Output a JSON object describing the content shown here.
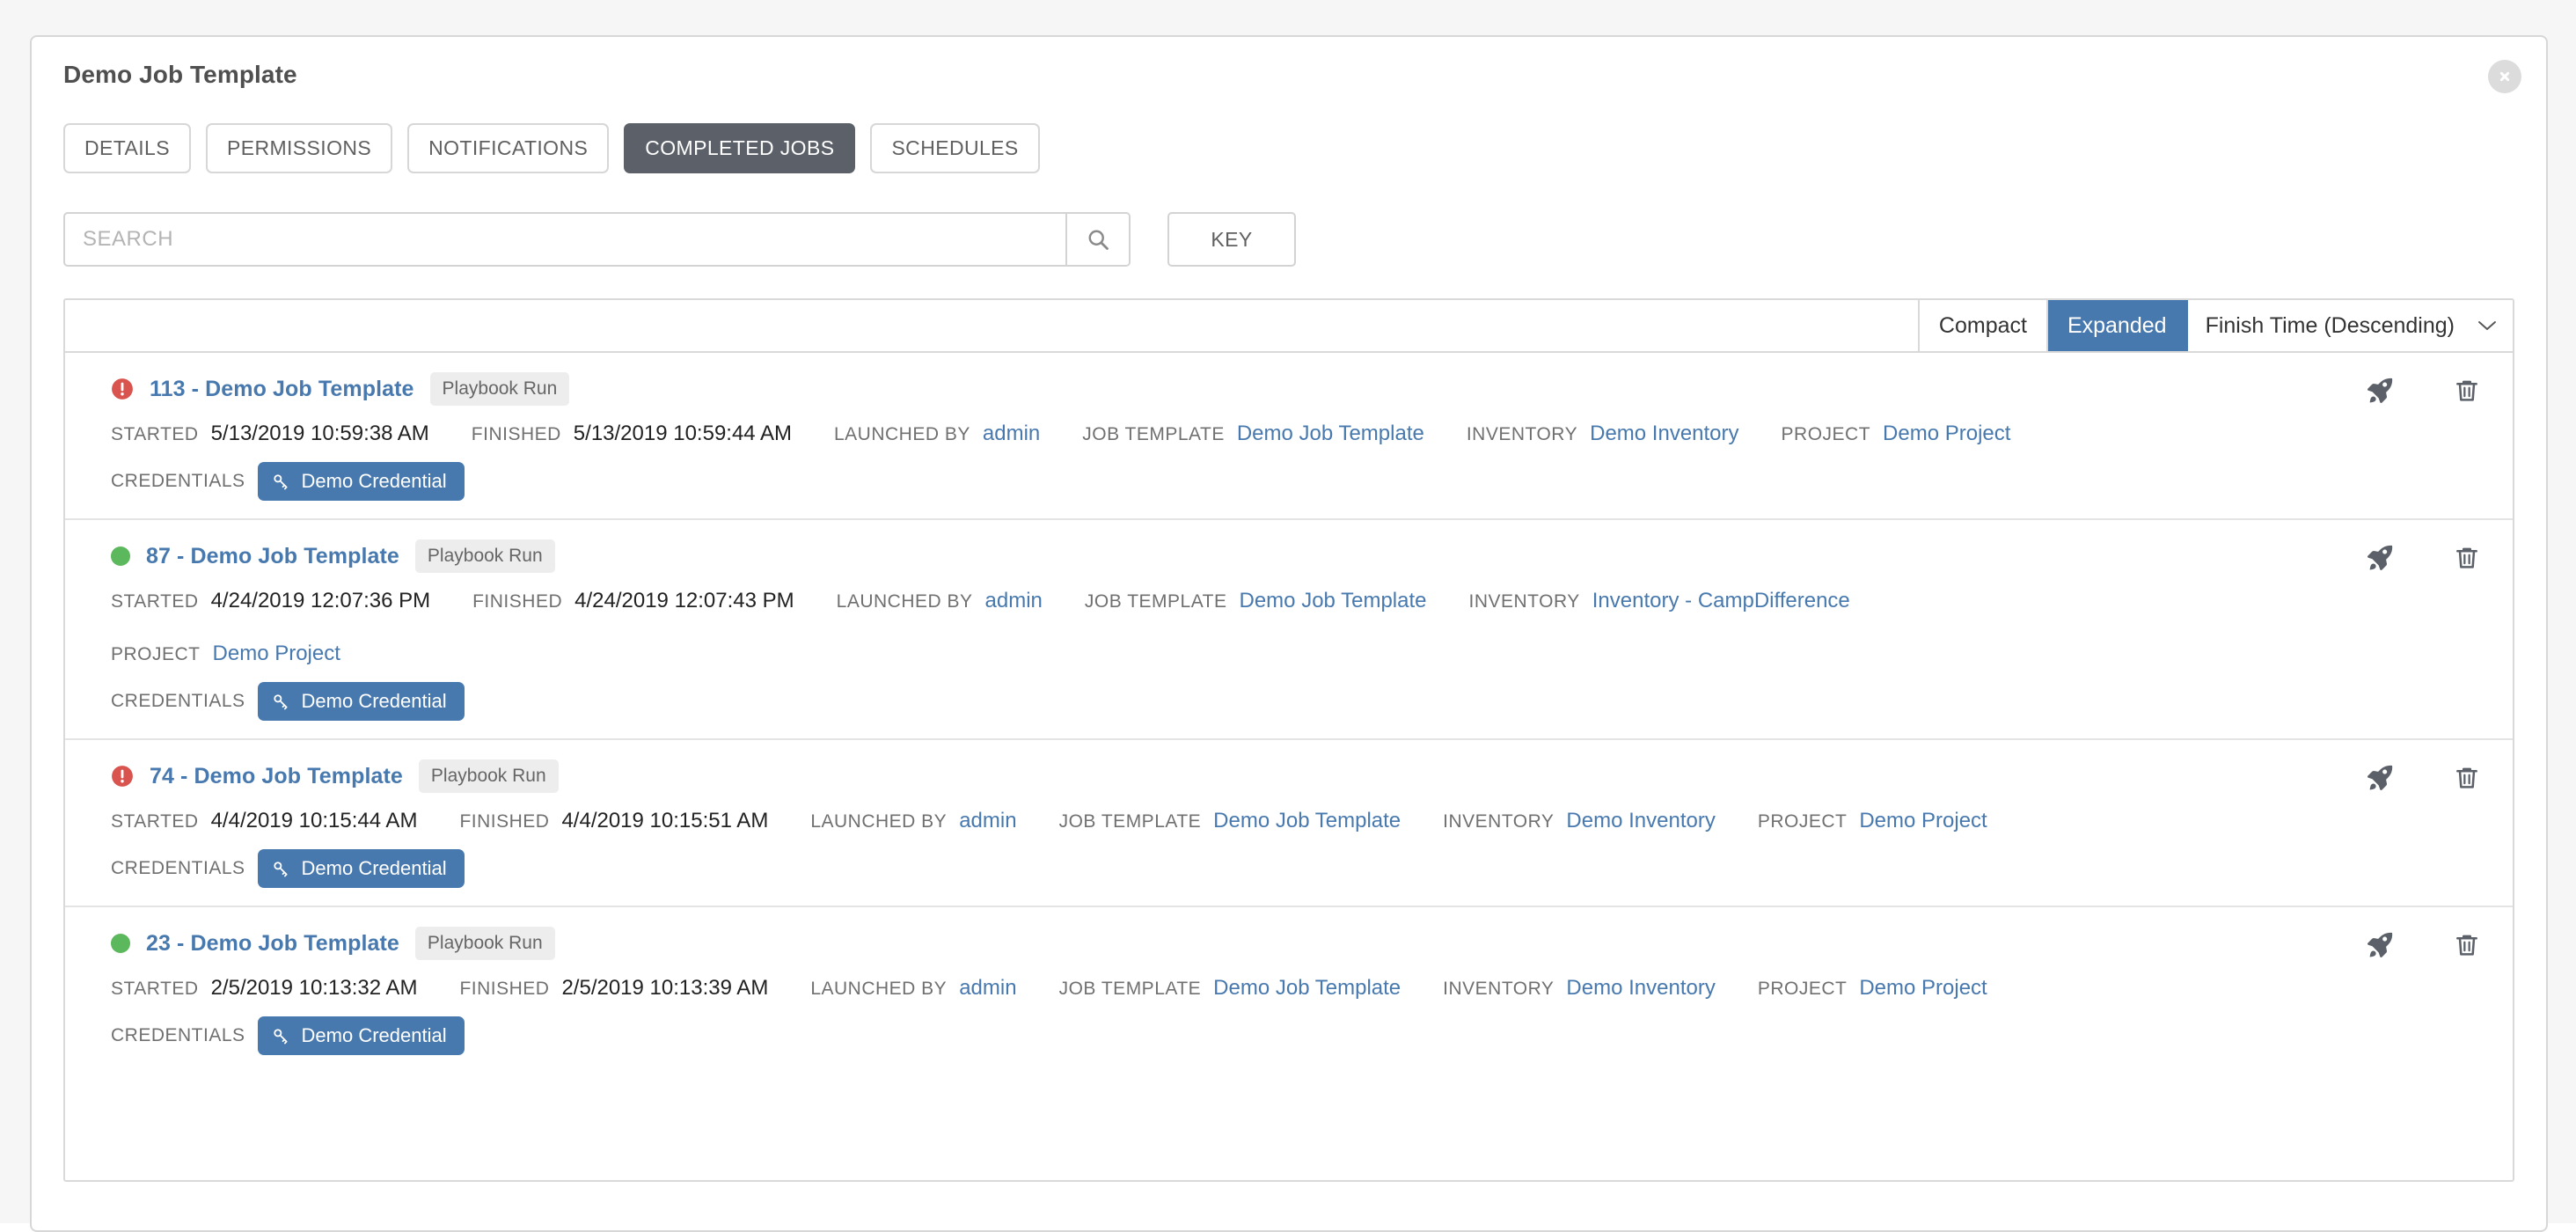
{
  "panel": {
    "title": "Demo Job Template",
    "close_label": "close-icon"
  },
  "tabs": [
    {
      "label": "DETAILS",
      "active": false
    },
    {
      "label": "PERMISSIONS",
      "active": false
    },
    {
      "label": "NOTIFICATIONS",
      "active": false
    },
    {
      "label": "COMPLETED JOBS",
      "active": true
    },
    {
      "label": "SCHEDULES",
      "active": false
    }
  ],
  "search": {
    "placeholder": "SEARCH",
    "value": "",
    "submit_icon": "search-icon",
    "key_label": "KEY"
  },
  "list_toolbar": {
    "compact_label": "Compact",
    "expanded_label": "Expanded",
    "active_view": "Expanded",
    "sort_label": "Finish Time (Descending)"
  },
  "labels": {
    "started": "STARTED",
    "finished": "FINISHED",
    "launched_by": "LAUNCHED BY",
    "job_template": "JOB TEMPLATE",
    "inventory": "INVENTORY",
    "project": "PROJECT",
    "credentials": "CREDENTIALS"
  },
  "colors": {
    "accent": "#4879ae",
    "failed": "#d9534f",
    "success": "#5cb85c",
    "tab_active_bg": "#5c6169"
  },
  "jobs": [
    {
      "id": "113",
      "name": "113 - Demo Job Template",
      "status": "failed",
      "type": "Playbook Run",
      "started": "5/13/2019 10:59:38 AM",
      "finished": "5/13/2019 10:59:44 AM",
      "launched_by": "admin",
      "job_template": "Demo Job Template",
      "inventory": "Demo Inventory",
      "project": "Demo Project",
      "credentials": "Demo Credential",
      "wrap_before_project": false
    },
    {
      "id": "87",
      "name": "87 - Demo Job Template",
      "status": "successful",
      "type": "Playbook Run",
      "started": "4/24/2019 12:07:36 PM",
      "finished": "4/24/2019 12:07:43 PM",
      "launched_by": "admin",
      "job_template": "Demo Job Template",
      "inventory": "Inventory - CampDifference",
      "project": "Demo Project",
      "credentials": "Demo Credential",
      "wrap_before_project": true
    },
    {
      "id": "74",
      "name": "74 - Demo Job Template",
      "status": "failed",
      "type": "Playbook Run",
      "started": "4/4/2019 10:15:44 AM",
      "finished": "4/4/2019 10:15:51 AM",
      "launched_by": "admin",
      "job_template": "Demo Job Template",
      "inventory": "Demo Inventory",
      "project": "Demo Project",
      "credentials": "Demo Credential",
      "wrap_before_project": false
    },
    {
      "id": "23",
      "name": "23 - Demo Job Template",
      "status": "successful",
      "type": "Playbook Run",
      "started": "2/5/2019 10:13:32 AM",
      "finished": "2/5/2019 10:13:39 AM",
      "launched_by": "admin",
      "job_template": "Demo Job Template",
      "inventory": "Demo Inventory",
      "project": "Demo Project",
      "credentials": "Demo Credential",
      "wrap_before_project": false
    }
  ],
  "row_actions": {
    "relaunch_icon": "rocket-icon",
    "delete_icon": "trash-icon"
  }
}
